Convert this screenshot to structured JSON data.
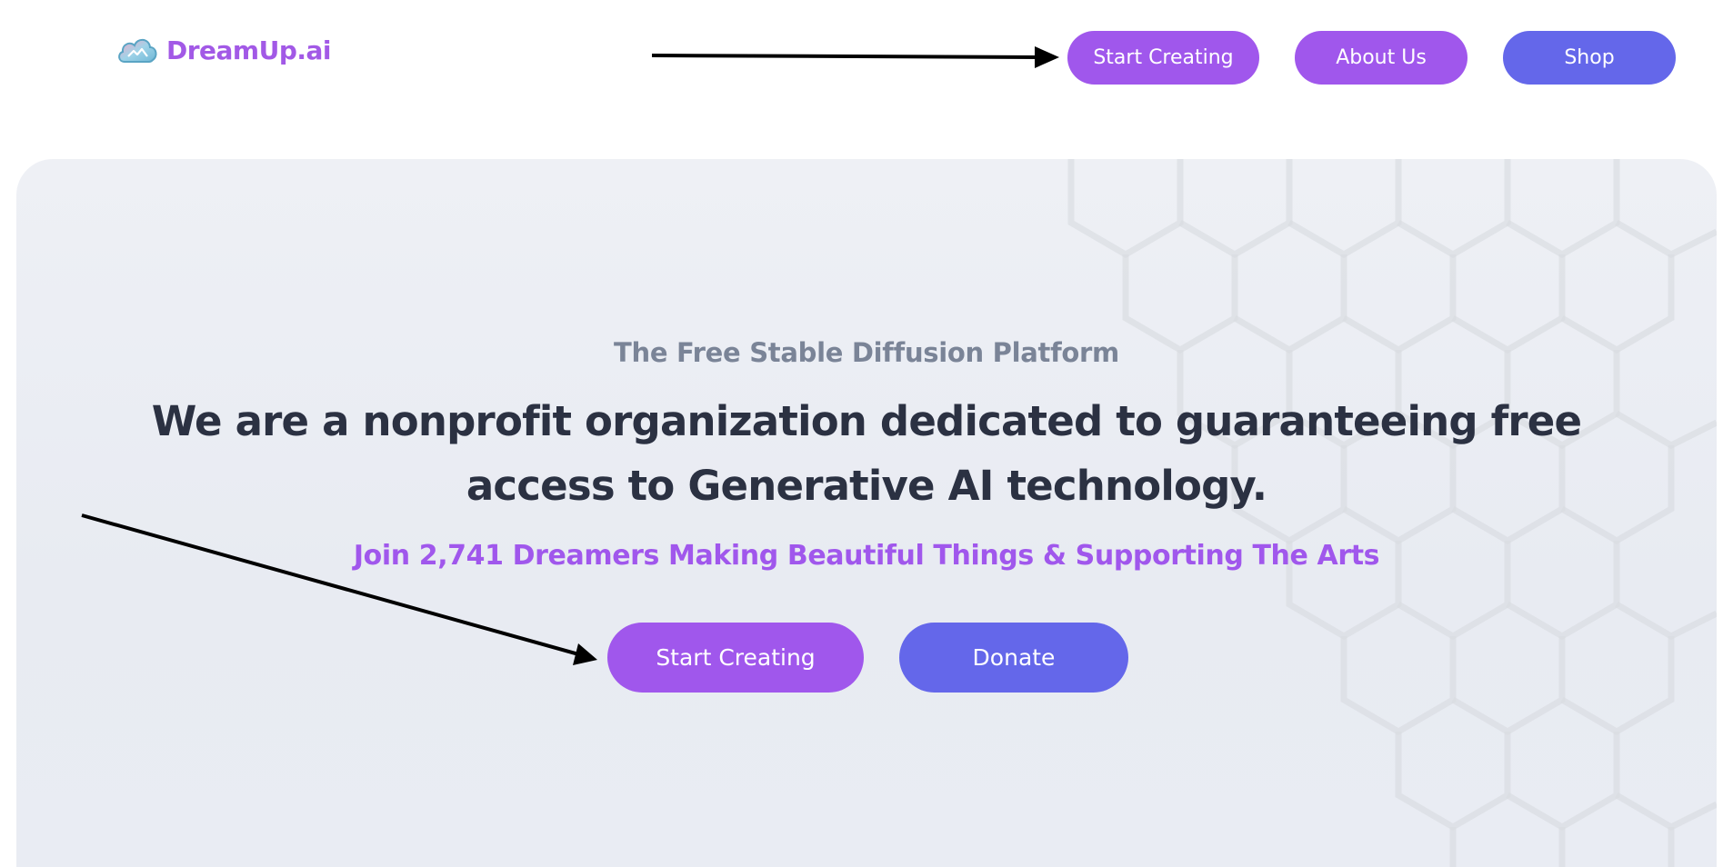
{
  "header": {
    "logo_text": "DreamUp.ai",
    "logo_icon": "cloud-icon",
    "nav": {
      "start_creating": "Start Creating",
      "about_us": "About Us",
      "shop": "Shop"
    }
  },
  "hero": {
    "subtitle": "The Free Stable Diffusion Platform",
    "headline": "We are a nonprofit organization dedicated to guaranteeing free access to Generative AI technology.",
    "tagline": "Join 2,741 Dreamers Making Beautiful Things & Supporting The Arts",
    "buttons": {
      "start_creating": "Start Creating",
      "donate": "Donate"
    }
  },
  "colors": {
    "purple": "#a057ec",
    "indigo": "#6467ea",
    "heading": "#2b3142",
    "subtitle": "#7a8497",
    "hero_bg": "#eceef4"
  }
}
